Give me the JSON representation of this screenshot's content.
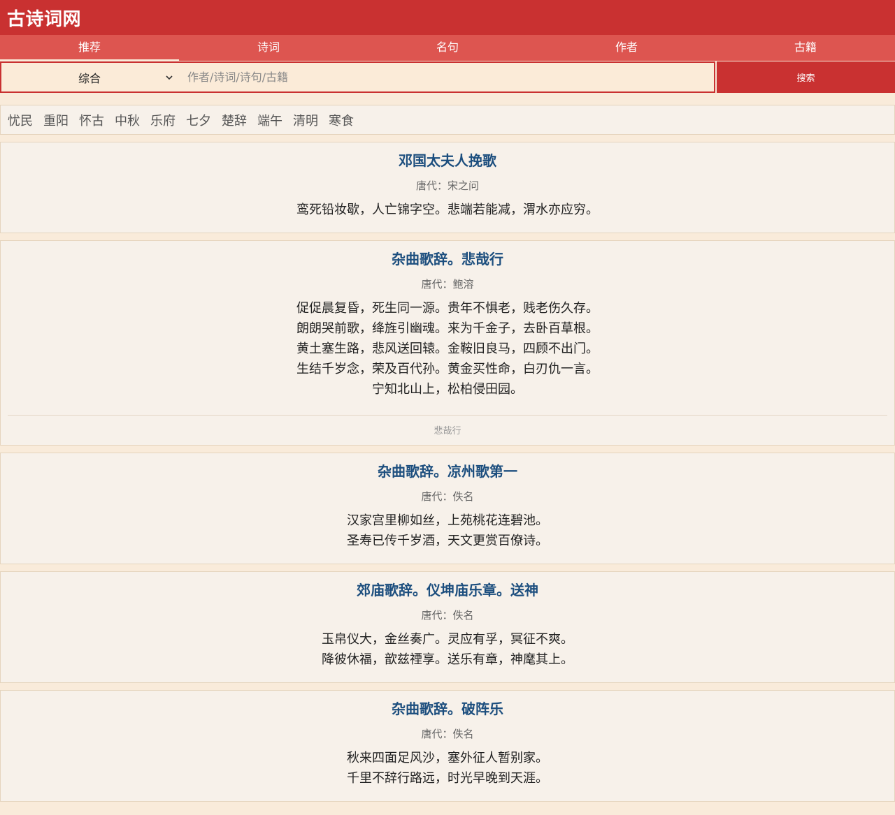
{
  "site": {
    "title": "古诗词网"
  },
  "nav": {
    "tabs": [
      {
        "label": "推荐",
        "active": true
      },
      {
        "label": "诗词",
        "active": false
      },
      {
        "label": "名句",
        "active": false
      },
      {
        "label": "作者",
        "active": false
      },
      {
        "label": "古籍",
        "active": false
      }
    ]
  },
  "search": {
    "category": "综合",
    "placeholder": "作者/诗词/诗句/古籍",
    "value": "",
    "button_label": "搜索"
  },
  "tags": [
    "忧民",
    "重阳",
    "怀古",
    "中秋",
    "乐府",
    "七夕",
    "楚辞",
    "端午",
    "清明",
    "寒食"
  ],
  "poems": [
    {
      "title": "邓国太夫人挽歌",
      "dynasty": "唐代",
      "separator": "：",
      "author": "宋之问",
      "lines": [
        "鸾死铅妆歇，人亡锦字空。悲端若能减，渭水亦应穷。"
      ],
      "footer": ""
    },
    {
      "title": "杂曲歌辞。悲哉行",
      "dynasty": "唐代",
      "separator": "：",
      "author": "鲍溶",
      "lines": [
        "促促晨复昏，死生同一源。贵年不惧老，贱老伤久存。",
        "朗朗哭前歌，绛旌引幽魂。来为千金子，去卧百草根。",
        "黄土塞生路，悲风送回辕。金鞍旧良马，四顾不出门。",
        "生结千岁念，荣及百代孙。黄金买性命，白刃仇一言。",
        "宁知北山上，松柏侵田园。"
      ],
      "footer": "悲哉行"
    },
    {
      "title": "杂曲歌辞。凉州歌第一",
      "dynasty": "唐代",
      "separator": "：",
      "author": "佚名",
      "lines": [
        "汉家宫里柳如丝，上苑桃花连碧池。",
        "圣寿已传千岁酒，天文更赏百僚诗。"
      ],
      "footer": ""
    },
    {
      "title": "郊庙歌辞。仪坤庙乐章。送神",
      "dynasty": "唐代",
      "separator": "：",
      "author": "佚名",
      "lines": [
        "玉帛仪大，金丝奏广。灵应有孚，冥征不爽。",
        "降彼休福，歆兹禋享。送乐有章，神麾其上。"
      ],
      "footer": ""
    },
    {
      "title": "杂曲歌辞。破阵乐",
      "dynasty": "唐代",
      "separator": "：",
      "author": "佚名",
      "lines": [
        "秋来四面足风沙，塞外征人暂别家。",
        "千里不辞行路远，时光早晚到天涯。"
      ],
      "footer": ""
    }
  ]
}
